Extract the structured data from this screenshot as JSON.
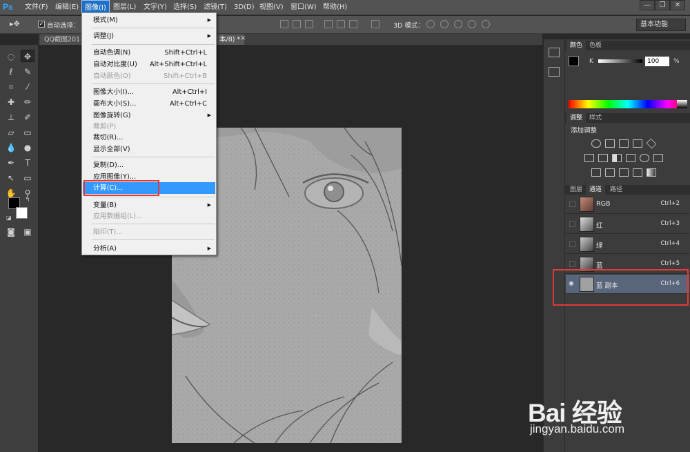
{
  "app": {
    "logo": "Ps"
  },
  "menubar": {
    "items": [
      "文件(F)",
      "编辑(E)",
      "图像(I)",
      "图层(L)",
      "文字(Y)",
      "选择(S)",
      "滤镜(T)",
      "3D(D)",
      "视图(V)",
      "窗口(W)",
      "帮助(H)"
    ],
    "active": "图像(I)",
    "window_buttons": [
      "—",
      "❐",
      "✕"
    ]
  },
  "options_bar": {
    "auto_select_label": "自动选择：",
    "mode_3d_label": "3D 模式：",
    "workspace": "基本功能"
  },
  "document_tabs": [
    {
      "label": "QQ截图201",
      "active": false
    },
    {
      "label": "本/8) *",
      "active": true
    }
  ],
  "tab_close": "×",
  "image_menu": [
    {
      "label": "模式(M)",
      "submenu": true
    },
    {
      "sep": true
    },
    {
      "label": "调整(J)",
      "submenu": true
    },
    {
      "sep": true
    },
    {
      "label": "自动色调(N)",
      "shortcut": "Shift+Ctrl+L"
    },
    {
      "label": "自动对比度(U)",
      "shortcut": "Alt+Shift+Ctrl+L"
    },
    {
      "label": "自动颜色(O)",
      "shortcut": "Shift+Ctrl+B",
      "disabled": true
    },
    {
      "sep": true
    },
    {
      "label": "图像大小(I)...",
      "shortcut": "Alt+Ctrl+I"
    },
    {
      "label": "画布大小(S)...",
      "shortcut": "Alt+Ctrl+C"
    },
    {
      "label": "图像旋转(G)",
      "submenu": true
    },
    {
      "label": "裁剪(P)",
      "disabled": true
    },
    {
      "label": "裁切(R)..."
    },
    {
      "label": "显示全部(V)"
    },
    {
      "sep": true
    },
    {
      "label": "复制(D)..."
    },
    {
      "label": "应用图像(Y)..."
    },
    {
      "label": "计算(C)...",
      "highlighted": true
    },
    {
      "sep": true
    },
    {
      "label": "变量(B)",
      "submenu": true
    },
    {
      "label": "应用数据组(L)...",
      "disabled": true
    },
    {
      "sep": true
    },
    {
      "label": "陷印(T)...",
      "disabled": true
    },
    {
      "sep": true
    },
    {
      "label": "分析(A)",
      "submenu": true
    }
  ],
  "color_panel": {
    "tabs": [
      "颜色",
      "色板"
    ],
    "channel_label": "K",
    "value": "100",
    "unit": "%"
  },
  "adjust_panel": {
    "tabs": [
      "调整",
      "样式"
    ],
    "title": "添加调整"
  },
  "channels_panel": {
    "tabs": [
      "图层",
      "通道",
      "路径"
    ],
    "rows": [
      {
        "name": "RGB",
        "key": "Ctrl+2",
        "selected": false
      },
      {
        "name": "红",
        "key": "Ctrl+3",
        "selected": false
      },
      {
        "name": "绿",
        "key": "Ctrl+4",
        "selected": false
      },
      {
        "name": "蓝",
        "key": "Ctrl+5",
        "selected": false
      },
      {
        "name": "蓝 副本",
        "key": "Ctrl+6",
        "selected": true
      }
    ]
  },
  "watermark": {
    "main": "Bai 经验",
    "sub": "jingyan.baidu.com"
  },
  "colors": {
    "highlight": "#3399ff",
    "annotation": "#e03a3a",
    "panel": "#3c3c3c"
  }
}
